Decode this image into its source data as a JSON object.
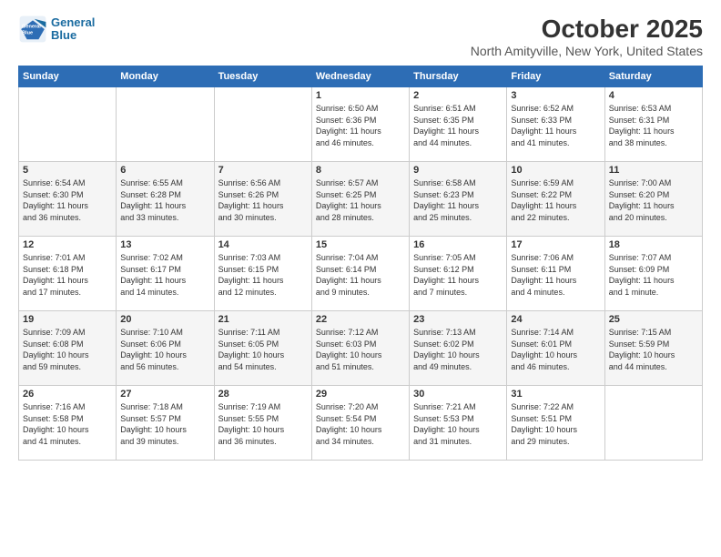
{
  "logo": {
    "line1": "General",
    "line2": "Blue"
  },
  "title": "October 2025",
  "subtitle": "North Amityville, New York, United States",
  "header_days": [
    "Sunday",
    "Monday",
    "Tuesday",
    "Wednesday",
    "Thursday",
    "Friday",
    "Saturday"
  ],
  "weeks": [
    [
      {
        "day": "",
        "content": ""
      },
      {
        "day": "",
        "content": ""
      },
      {
        "day": "",
        "content": ""
      },
      {
        "day": "1",
        "content": "Sunrise: 6:50 AM\nSunset: 6:36 PM\nDaylight: 11 hours\nand 46 minutes."
      },
      {
        "day": "2",
        "content": "Sunrise: 6:51 AM\nSunset: 6:35 PM\nDaylight: 11 hours\nand 44 minutes."
      },
      {
        "day": "3",
        "content": "Sunrise: 6:52 AM\nSunset: 6:33 PM\nDaylight: 11 hours\nand 41 minutes."
      },
      {
        "day": "4",
        "content": "Sunrise: 6:53 AM\nSunset: 6:31 PM\nDaylight: 11 hours\nand 38 minutes."
      }
    ],
    [
      {
        "day": "5",
        "content": "Sunrise: 6:54 AM\nSunset: 6:30 PM\nDaylight: 11 hours\nand 36 minutes."
      },
      {
        "day": "6",
        "content": "Sunrise: 6:55 AM\nSunset: 6:28 PM\nDaylight: 11 hours\nand 33 minutes."
      },
      {
        "day": "7",
        "content": "Sunrise: 6:56 AM\nSunset: 6:26 PM\nDaylight: 11 hours\nand 30 minutes."
      },
      {
        "day": "8",
        "content": "Sunrise: 6:57 AM\nSunset: 6:25 PM\nDaylight: 11 hours\nand 28 minutes."
      },
      {
        "day": "9",
        "content": "Sunrise: 6:58 AM\nSunset: 6:23 PM\nDaylight: 11 hours\nand 25 minutes."
      },
      {
        "day": "10",
        "content": "Sunrise: 6:59 AM\nSunset: 6:22 PM\nDaylight: 11 hours\nand 22 minutes."
      },
      {
        "day": "11",
        "content": "Sunrise: 7:00 AM\nSunset: 6:20 PM\nDaylight: 11 hours\nand 20 minutes."
      }
    ],
    [
      {
        "day": "12",
        "content": "Sunrise: 7:01 AM\nSunset: 6:18 PM\nDaylight: 11 hours\nand 17 minutes."
      },
      {
        "day": "13",
        "content": "Sunrise: 7:02 AM\nSunset: 6:17 PM\nDaylight: 11 hours\nand 14 minutes."
      },
      {
        "day": "14",
        "content": "Sunrise: 7:03 AM\nSunset: 6:15 PM\nDaylight: 11 hours\nand 12 minutes."
      },
      {
        "day": "15",
        "content": "Sunrise: 7:04 AM\nSunset: 6:14 PM\nDaylight: 11 hours\nand 9 minutes."
      },
      {
        "day": "16",
        "content": "Sunrise: 7:05 AM\nSunset: 6:12 PM\nDaylight: 11 hours\nand 7 minutes."
      },
      {
        "day": "17",
        "content": "Sunrise: 7:06 AM\nSunset: 6:11 PM\nDaylight: 11 hours\nand 4 minutes."
      },
      {
        "day": "18",
        "content": "Sunrise: 7:07 AM\nSunset: 6:09 PM\nDaylight: 11 hours\nand 1 minute."
      }
    ],
    [
      {
        "day": "19",
        "content": "Sunrise: 7:09 AM\nSunset: 6:08 PM\nDaylight: 10 hours\nand 59 minutes."
      },
      {
        "day": "20",
        "content": "Sunrise: 7:10 AM\nSunset: 6:06 PM\nDaylight: 10 hours\nand 56 minutes."
      },
      {
        "day": "21",
        "content": "Sunrise: 7:11 AM\nSunset: 6:05 PM\nDaylight: 10 hours\nand 54 minutes."
      },
      {
        "day": "22",
        "content": "Sunrise: 7:12 AM\nSunset: 6:03 PM\nDaylight: 10 hours\nand 51 minutes."
      },
      {
        "day": "23",
        "content": "Sunrise: 7:13 AM\nSunset: 6:02 PM\nDaylight: 10 hours\nand 49 minutes."
      },
      {
        "day": "24",
        "content": "Sunrise: 7:14 AM\nSunset: 6:01 PM\nDaylight: 10 hours\nand 46 minutes."
      },
      {
        "day": "25",
        "content": "Sunrise: 7:15 AM\nSunset: 5:59 PM\nDaylight: 10 hours\nand 44 minutes."
      }
    ],
    [
      {
        "day": "26",
        "content": "Sunrise: 7:16 AM\nSunset: 5:58 PM\nDaylight: 10 hours\nand 41 minutes."
      },
      {
        "day": "27",
        "content": "Sunrise: 7:18 AM\nSunset: 5:57 PM\nDaylight: 10 hours\nand 39 minutes."
      },
      {
        "day": "28",
        "content": "Sunrise: 7:19 AM\nSunset: 5:55 PM\nDaylight: 10 hours\nand 36 minutes."
      },
      {
        "day": "29",
        "content": "Sunrise: 7:20 AM\nSunset: 5:54 PM\nDaylight: 10 hours\nand 34 minutes."
      },
      {
        "day": "30",
        "content": "Sunrise: 7:21 AM\nSunset: 5:53 PM\nDaylight: 10 hours\nand 31 minutes."
      },
      {
        "day": "31",
        "content": "Sunrise: 7:22 AM\nSunset: 5:51 PM\nDaylight: 10 hours\nand 29 minutes."
      },
      {
        "day": "",
        "content": ""
      }
    ]
  ]
}
